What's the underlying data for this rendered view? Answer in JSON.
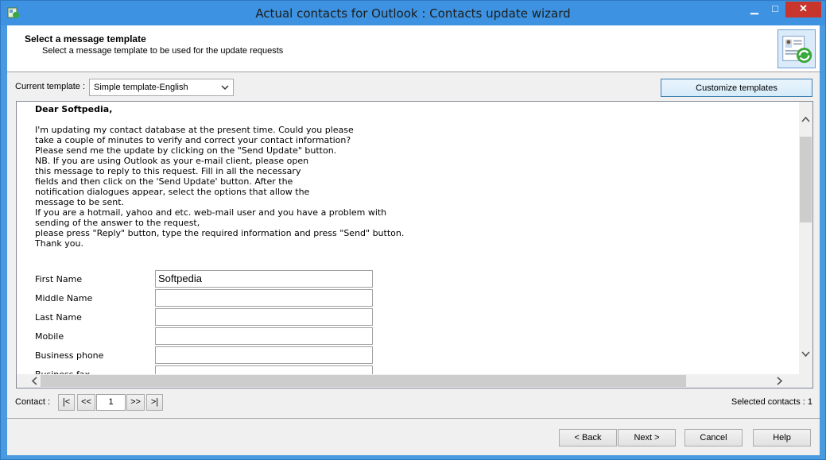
{
  "window": {
    "title": "Actual contacts for Outlook : Contacts update wizard",
    "minimize_glyph": "▁",
    "maximize_glyph": "□",
    "close_glyph": "✕"
  },
  "header": {
    "title": "Select a message template",
    "subtitle": "Select a message template to be used for the update requests"
  },
  "template": {
    "label": "Current template :",
    "selected": "Simple template-English",
    "customize_label": "Customize templates"
  },
  "letter": {
    "greeting": "Dear Softpedia,",
    "body": "I'm updating my contact database at the present time. Could you please\ntake a couple of minutes to verify and correct your contact information?\nPlease send me the update by clicking on the \"Send Update\" button.\nNB. If you are using Outlook as your e-mail client, please open\nthis message to reply to this request. Fill in all the necessary\nfields and then click on the 'Send Update' button. After the\nnotification dialogues appear, select the options that allow the\nmessage to be sent.\nIf you are a hotmail, yahoo and etc. web-mail user and you have a problem with\nsending of the answer to the request,\nplease press \"Reply\" button, type the required information and press \"Send\" button.\nThank you."
  },
  "form": {
    "fields": [
      {
        "label": "First Name",
        "value": "Softpedia"
      },
      {
        "label": "Middle Name",
        "value": ""
      },
      {
        "label": "Last Name",
        "value": ""
      },
      {
        "label": "Mobile",
        "value": ""
      },
      {
        "label": "Business phone",
        "value": ""
      },
      {
        "label": "Business fax",
        "value": ""
      }
    ]
  },
  "nav": {
    "label": "Contact :",
    "first": "|<",
    "prev": "<<",
    "current": "1",
    "next": ">>",
    "last": ">|",
    "selected_contacts": "Selected contacts : 1"
  },
  "footer": {
    "back": "< Back",
    "next": "Next >",
    "cancel": "Cancel",
    "help": "Help"
  },
  "colors": {
    "titlebar": "#3d93e1",
    "close_button": "#c7352c",
    "accent_border": "#3c7fb1"
  }
}
